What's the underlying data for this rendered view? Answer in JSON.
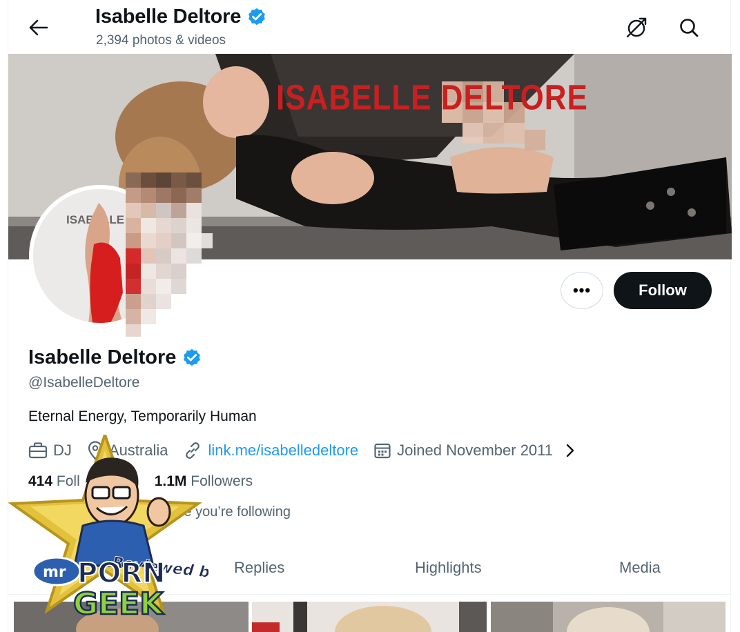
{
  "header": {
    "title": "Isabelle Deltore",
    "subtitle": "2,394 photos & videos"
  },
  "banner": {
    "text": "ISABELLE DELTORE"
  },
  "avatar": {
    "text": "ISABELLE DELTORE"
  },
  "actions": {
    "more_label": "•••",
    "follow_label": "Follow"
  },
  "profile": {
    "name": "Isabelle Deltore",
    "handle": "@IsabelleDeltore",
    "bio": "Eternal Energy, Temporarily Human",
    "category": "DJ",
    "location": "Australia",
    "link": "link.me/isabelledeltore",
    "joined": "Joined November 2011"
  },
  "stats": {
    "following_count": "414",
    "following_label": "Foll",
    "followers_count": "1.1M",
    "followers_label": "Followers",
    "known_followers": "le you’re following"
  },
  "tabs": [
    "Replies",
    "Highlights",
    "Media"
  ],
  "watermark": {
    "line1": "Reviewed by",
    "line2a": "mr",
    "line2b": "PORN",
    "line3": "GEEK"
  },
  "colors": {
    "accent": "#1d9bf0",
    "verified": "#1d9bf0",
    "follow_bg": "#0f1419",
    "muted": "#536471"
  },
  "icons": [
    "back-arrow-icon",
    "verified-badge-icon",
    "hide-icon",
    "search-icon",
    "briefcase-icon",
    "location-icon",
    "link-icon",
    "calendar-icon",
    "chevron-right-icon"
  ]
}
